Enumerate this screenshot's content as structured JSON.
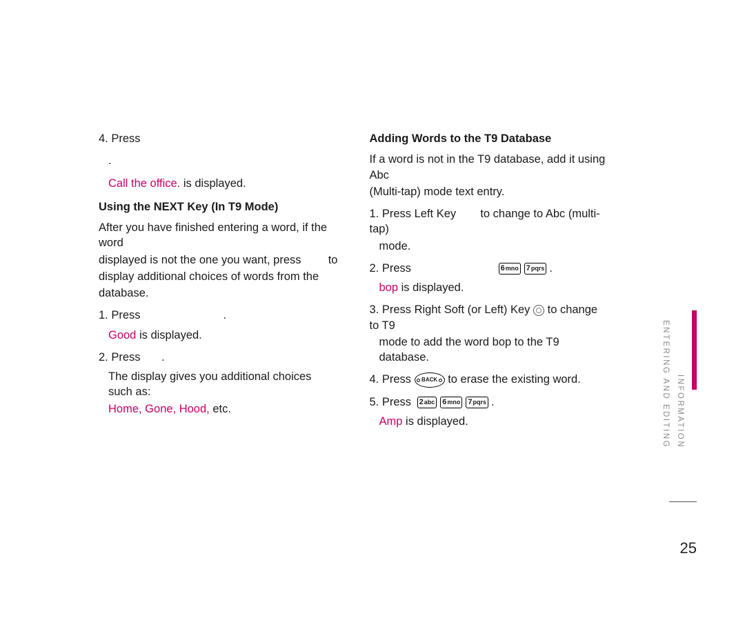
{
  "left": {
    "press_label": "4. Press",
    "blank_period": ".",
    "call_office_pink": "Call the office.",
    "call_office_rest": " is displayed.",
    "section_title": "Using the NEXT Key (In T9 Mode)",
    "intro_a": "After you have finished entering a word, if the word",
    "intro_b_pre": "displayed is not the one you want, press ",
    "intro_b_post": " to",
    "intro_c": "display additional choices of words from the",
    "intro_d": "database.",
    "s1_press": "1. Press",
    "s1_post": ".",
    "s1_good": "Good",
    "s1_good_rest": " is displayed.",
    "s2_press": "2. Press ",
    "s2_post": ".",
    "s2_line": "The display gives you additional choices such as:",
    "s2_pink": "Home, Gone, Hood,",
    "s2_rest": " etc."
  },
  "right": {
    "section_title": "Adding Words to the T9 Database",
    "intro_a": "If a word is not in the T9 database, add it using Abc",
    "intro_b": "(Multi-tap) mode text entry.",
    "s1_a_pre": "1. Press Left Key ",
    "s1_a_post": " to change to Abc (multi-tap)",
    "s1_b": "mode.",
    "s2_press": "2. Press",
    "s2_post": ".",
    "s2_bop": "bop",
    "s2_bop_rest": " is displayed.",
    "s3_a_pre": "3. Press Right Soft (or Left) Key ",
    "s3_a_post": " to change to T9",
    "s3_b": "mode to add the word bop to the T9 database.",
    "s4_pre": "4. Press ",
    "s4_post": " to erase the existing word.",
    "s5_pre": "5. Press ",
    "s5_post": ".",
    "s5_amp": "Amp",
    "s5_amp_rest": " is displayed."
  },
  "keys": {
    "six_num": "6",
    "six_sub": "mno",
    "seven_num": "7",
    "seven_sub": "pqrs",
    "two_num": "2",
    "two_sub": "abc",
    "back": "BACK"
  },
  "sidebar": {
    "line1": "ENTERING AND EDITING",
    "line2": "INFORMATION"
  },
  "page_number": "25"
}
